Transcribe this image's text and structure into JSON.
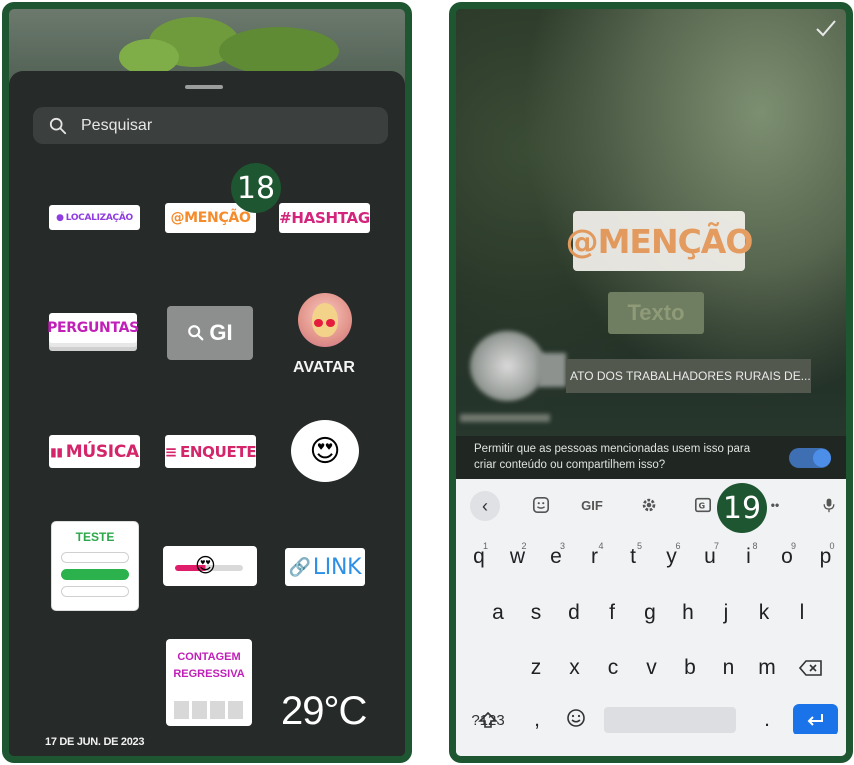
{
  "left_screen": {
    "search": {
      "placeholder": "Pesquisar"
    },
    "stickers": {
      "location": "LOCALIZAÇÃO",
      "mention": "@MENÇÃO",
      "hashtag": "#HASHTAG",
      "questions": "PERGUNTAS",
      "gif": "GI",
      "avatar": "AVATAR",
      "music": "MÚSICA",
      "poll": "ENQUETE",
      "quiz": "TESTE",
      "link": "LINK",
      "date": "17 DE JUN. DE 2023",
      "countdown_line1": "CONTAGEM",
      "countdown_line2": "REGRESSIVA",
      "temperature": "29°C"
    },
    "step_badge": "18"
  },
  "right_screen": {
    "mention_sticker": "@MENÇÃO",
    "text_sticker": "Texto",
    "post_text": "ATO DOS TRABALHADORES RURAIS DE...",
    "permission_text": "Permitir que as pessoas mencionadas usem isso para criar conteúdo ou compartilhem isso?",
    "permission_toggle_on": true,
    "step_badge": "19",
    "keyboard": {
      "toolbar": {
        "gif": "GIF",
        "more": "••"
      },
      "row1": [
        {
          "key": "q",
          "hint": "1"
        },
        {
          "key": "w",
          "hint": "2"
        },
        {
          "key": "e",
          "hint": "3"
        },
        {
          "key": "r",
          "hint": "4"
        },
        {
          "key": "t",
          "hint": "5"
        },
        {
          "key": "y",
          "hint": "6"
        },
        {
          "key": "u",
          "hint": "7"
        },
        {
          "key": "i",
          "hint": "8"
        },
        {
          "key": "o",
          "hint": "9"
        },
        {
          "key": "p",
          "hint": "0"
        }
      ],
      "row2": [
        "a",
        "s",
        "d",
        "f",
        "g",
        "h",
        "j",
        "k",
        "l"
      ],
      "row3": [
        "z",
        "x",
        "c",
        "v",
        "b",
        "n",
        "m"
      ],
      "symbols_key": "?123",
      "comma_key": ",",
      "period_key": "."
    }
  },
  "colors": {
    "frame_green": "#1e5631",
    "accent_blue": "#1a73e8",
    "mention_orange": "#f58b2b",
    "hashtag_pink": "#d4247c"
  }
}
